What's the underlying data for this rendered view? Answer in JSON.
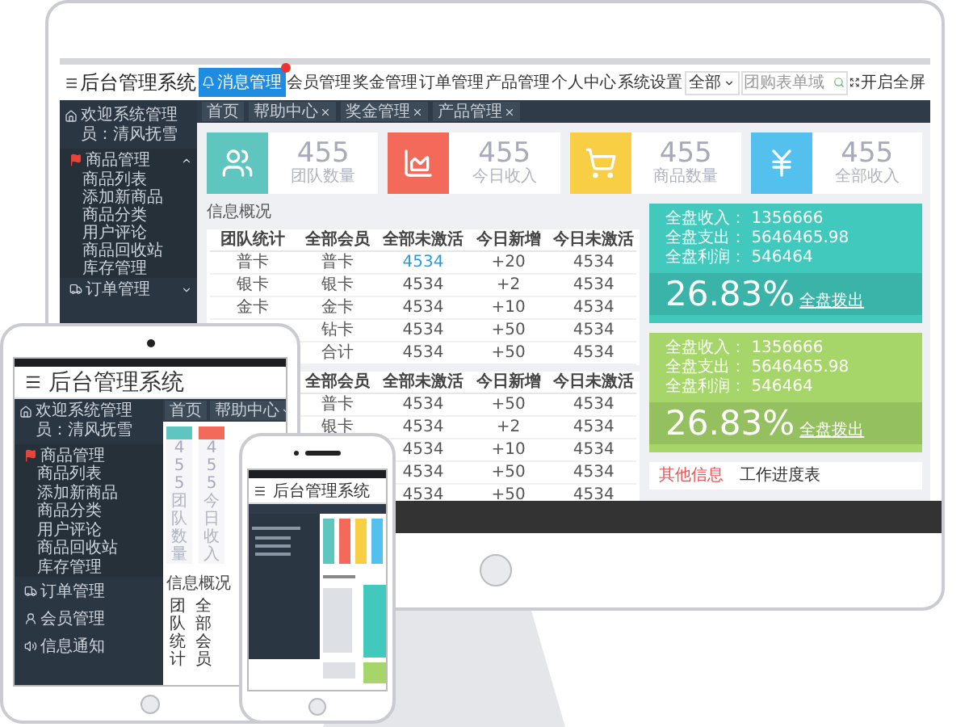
{
  "monitor": {
    "header": {
      "title": "后台管理系统",
      "message_button": "消息管理",
      "nav": [
        "会员管理",
        "奖金管理",
        "订单管理",
        "产品管理",
        "个人中心",
        "系统设置"
      ],
      "search": {
        "scope": "全部",
        "placeholder": "团购表单域"
      },
      "fullscreen": "开启全屏"
    },
    "tabs": [
      {
        "label": "首页",
        "closable": false
      },
      {
        "label": "帮助中心",
        "closable": true
      },
      {
        "label": "奖金管理",
        "closable": true
      },
      {
        "label": "产品管理",
        "closable": true
      }
    ],
    "sidebar": {
      "welcome": "欢迎系统管理员：清风抚雪",
      "groups": [
        {
          "label": "商品管理",
          "kind": "goods",
          "expanded": true,
          "children": [
            "商品列表",
            "添加新商品",
            "商品分类",
            "用户评论",
            "商品回收站",
            "库存管理"
          ]
        },
        {
          "label": "订单管理",
          "kind": "orders",
          "expanded": false
        }
      ]
    },
    "stats": [
      {
        "kind": "team",
        "value": "455",
        "label": "团队数量",
        "color": "#5ec6bf"
      },
      {
        "kind": "income",
        "value": "455",
        "label": "今日收入",
        "color": "#f36a5a"
      },
      {
        "kind": "goods",
        "value": "455",
        "label": "商品数量",
        "color": "#f8cf44"
      },
      {
        "kind": "money",
        "value": "455",
        "label": "全部收入",
        "color": "#54c0ee"
      }
    ],
    "info": {
      "title": "信息概况",
      "tables": [
        {
          "columns": [
            "团队统计",
            "全部会员",
            "全部未激活",
            "今日新增",
            "今日未激活"
          ],
          "rows": [
            {
              "cells": [
                "普卡",
                "普卡",
                {
                  "text": "4534",
                  "kind": "link"
                },
                "+20",
                "4534"
              ]
            },
            {
              "cells": [
                "银卡",
                "银卡",
                "4534",
                "+2",
                "4534"
              ]
            },
            {
              "cells": [
                "金卡",
                "金卡",
                "4534",
                "+10",
                "4534"
              ]
            },
            {
              "cells": [
                "钻卡",
                "4534",
                "+50",
                "4534"
              ]
            },
            {
              "cells": [
                "合计",
                "4534",
                "+50",
                "4534"
              ]
            }
          ]
        },
        {
          "columns": [
            "全部会员",
            "全部未激活",
            "今日新增",
            "今日未激活"
          ],
          "rows": [
            {
              "cells": [
                "普卡",
                "4534",
                "+50",
                "4534"
              ]
            },
            {
              "cells": [
                "银卡",
                "4534",
                "+2",
                "4534"
              ]
            },
            {
              "cells": [
                "4534",
                "+10",
                "4534"
              ]
            },
            {
              "cells": [
                "4534",
                "+50",
                "4534"
              ]
            },
            {
              "cells": [
                "4534",
                "+50",
                "4534"
              ]
            }
          ]
        }
      ]
    },
    "summaries": [
      {
        "color": "#41c9bd",
        "lines": [
          {
            "label": "全盘收入：",
            "value": "1356666"
          },
          {
            "label": "全盘支出：",
            "value": "5646465.98"
          },
          {
            "label": "全盘利润：",
            "value": "546464"
          }
        ],
        "percent": "26.83%",
        "caption": "全盘拨出"
      },
      {
        "color": "#a6d66a",
        "lines": [
          {
            "label": "全盘收入：",
            "value": "1356666"
          },
          {
            "label": "全盘支出：",
            "value": "5646465.98"
          },
          {
            "label": "全盘利润：",
            "value": "546464"
          }
        ],
        "percent": "26.83%",
        "caption": "全盘拨出"
      }
    ],
    "bottom_tabs": [
      {
        "label": "其他信息",
        "selected": true
      },
      {
        "label": "工作进度表",
        "selected": false
      }
    ]
  },
  "tablet": {
    "title": "后台管理系统",
    "welcome": "欢迎系统管理员：清风抚雪",
    "groups": [
      {
        "label": "商品管理",
        "kind": "goods",
        "expanded": true,
        "children": [
          "商品列表",
          "添加新商品",
          "商品分类",
          "用户评论",
          "商品回收站",
          "库存管理"
        ]
      },
      {
        "label": "订单管理",
        "kind": "orders",
        "expanded": false
      },
      {
        "label": "会员管理",
        "kind": "members",
        "expanded": false
      },
      {
        "label": "信息通知",
        "kind": "notice",
        "expanded": false
      }
    ],
    "tabs": [
      {
        "label": "首页",
        "dropdown": false
      },
      {
        "label": "帮助中心",
        "dropdown": true
      }
    ],
    "stats": [
      {
        "value": "455",
        "label": "团队数量",
        "color": "#5ec6bf"
      },
      {
        "value": "455",
        "label": "今日收入",
        "color": "#f36a5a"
      }
    ],
    "info_title": "信息概况",
    "columns": [
      "团队统计",
      "全部会员"
    ]
  },
  "phone": {
    "title": "后台管理系统"
  }
}
